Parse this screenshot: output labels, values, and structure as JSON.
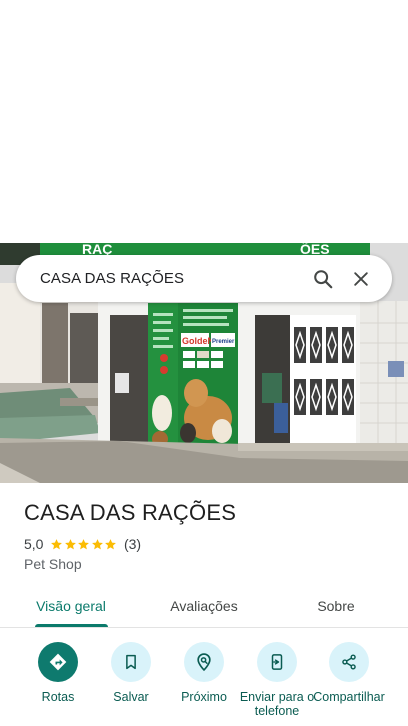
{
  "search": {
    "query": "CASA DAS RAÇÕES"
  },
  "place": {
    "name": "CASA DAS RAÇÕES",
    "rating": "5,0",
    "review_count": "(3)",
    "stars": 5,
    "category": "Pet Shop"
  },
  "photo_sign": {
    "title_left": "RAÇ",
    "title_right": "ÕES",
    "brand": "GoldeN",
    "brand2": "Premier"
  },
  "tabs": [
    {
      "label": "Visão geral",
      "active": true
    },
    {
      "label": "Avaliações",
      "active": false
    },
    {
      "label": "Sobre",
      "active": false
    }
  ],
  "actions": [
    {
      "label": "Rotas",
      "icon": "directions-icon"
    },
    {
      "label": "Salvar",
      "icon": "bookmark-icon"
    },
    {
      "label": "Próximo",
      "icon": "nearby-icon"
    },
    {
      "label": "Enviar para o telefone",
      "icon": "send-to-phone-icon"
    },
    {
      "label": "Compartilhar",
      "icon": "share-icon"
    }
  ],
  "colors": {
    "accent": "#0b7a6b",
    "action_bg": "#d9f3fa",
    "primary_action": "#0e7a6e",
    "star": "#fbbc04",
    "storefront_green": "#1f8f3c"
  }
}
